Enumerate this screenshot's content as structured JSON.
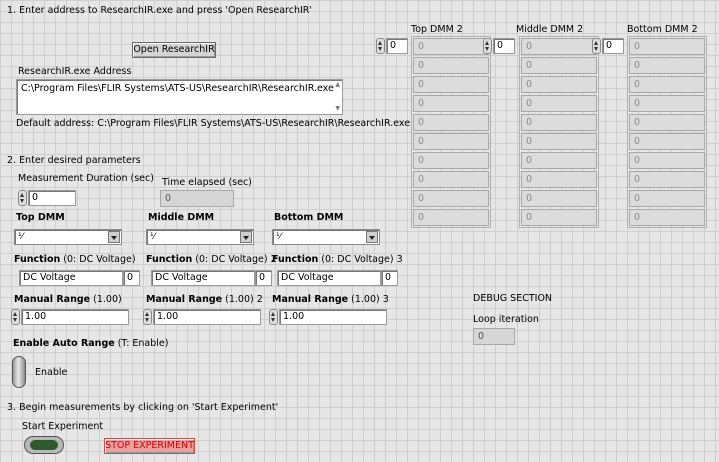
{
  "step1": {
    "heading": "1. Enter address to ResearchIR.exe and press 'Open ResearchIR'",
    "open_button": "Open ResearchIR",
    "address_label": "ResearchIR.exe Address",
    "address_value": "C:\\Program Files\\FLIR Systems\\ATS-US\\ResearchIR\\ResearchIR.exe",
    "default_address": "Default address: C:\\Program Files\\FLIR Systems\\ATS-US\\ResearchIR\\ResearchIR.exe"
  },
  "dmm_arrays": [
    {
      "title": "Top DMM 2",
      "index": "0",
      "values": [
        "0",
        "0",
        "0",
        "0",
        "0",
        "0",
        "0",
        "0",
        "0",
        "0"
      ]
    },
    {
      "title": "Middle DMM 2",
      "index": "0",
      "values": [
        "0",
        "0",
        "0",
        "0",
        "0",
        "0",
        "0",
        "0",
        "0",
        "0"
      ]
    },
    {
      "title": "Bottom DMM 2",
      "index": "0",
      "values": [
        "0",
        "0",
        "0",
        "0",
        "0",
        "0",
        "0",
        "0",
        "0",
        "0"
      ]
    }
  ],
  "step2": {
    "heading": "2. Enter desired parameters",
    "duration_label": "Measurement Duration (sec)",
    "duration_value": "0",
    "elapsed_label": "Time elapsed (sec)",
    "elapsed_value": "0"
  },
  "dmms": [
    {
      "title": "Top DMM",
      "function_label_bold": "Function",
      "function_label_rest": " (0: DC Voltage)",
      "function_value": "DC Voltage",
      "function_code": "0",
      "range_label_bold": "Manual Range",
      "range_label_rest": " (1.00)",
      "range_value": "1.00"
    },
    {
      "title": "Middle DMM",
      "function_label_bold": "Function",
      "function_label_rest": " (0: DC Voltage) 2",
      "function_value": "DC Voltage",
      "function_code": "0",
      "range_label_bold": "Manual Range",
      "range_label_rest": " (1.00) 2",
      "range_value": "1.00"
    },
    {
      "title": "Bottom DMM",
      "function_label_bold": "Function",
      "function_label_rest": " (0: DC Voltage) 3",
      "function_value": "DC Voltage",
      "function_code": "0",
      "range_label_bold": "Manual Range",
      "range_label_rest": " (1.00) 3",
      "range_value": "1.00"
    }
  ],
  "auto_range": {
    "label_bold": "Enable Auto Range",
    "label_rest": " (T: Enable)",
    "switch_text": "Enable"
  },
  "debug": {
    "heading": "DEBUG SECTION",
    "loop_label": "Loop iteration",
    "loop_value": "0"
  },
  "step3": {
    "heading": "3. Begin measurements by clicking on 'Start Experiment'",
    "start_label": "Start Experiment",
    "stop_button": "STOP EXPERIMENT"
  },
  "colors": {
    "led_green": "#2e5a2e",
    "stop_text": "#d00000",
    "stop_bg": "#e8a0a0"
  }
}
